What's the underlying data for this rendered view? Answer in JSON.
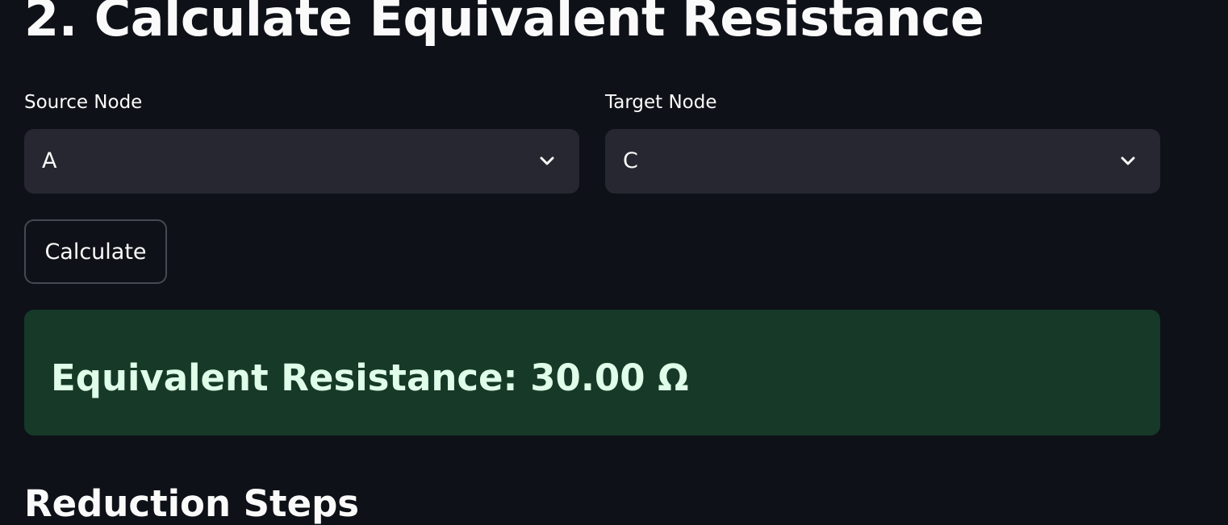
{
  "section": {
    "title": "2. Calculate Equivalent Resistance"
  },
  "source": {
    "label": "Source Node",
    "value": "A"
  },
  "target": {
    "label": "Target Node",
    "value": "C"
  },
  "calculate_button": "Calculate",
  "result": {
    "text": "Equivalent Resistance: 30.00 Ω"
  },
  "next_section": {
    "title": "Reduction Steps"
  },
  "colors": {
    "background": "#0e1117",
    "select_bg": "#262730",
    "success_bg": "#173928",
    "success_text": "#dffde9"
  }
}
